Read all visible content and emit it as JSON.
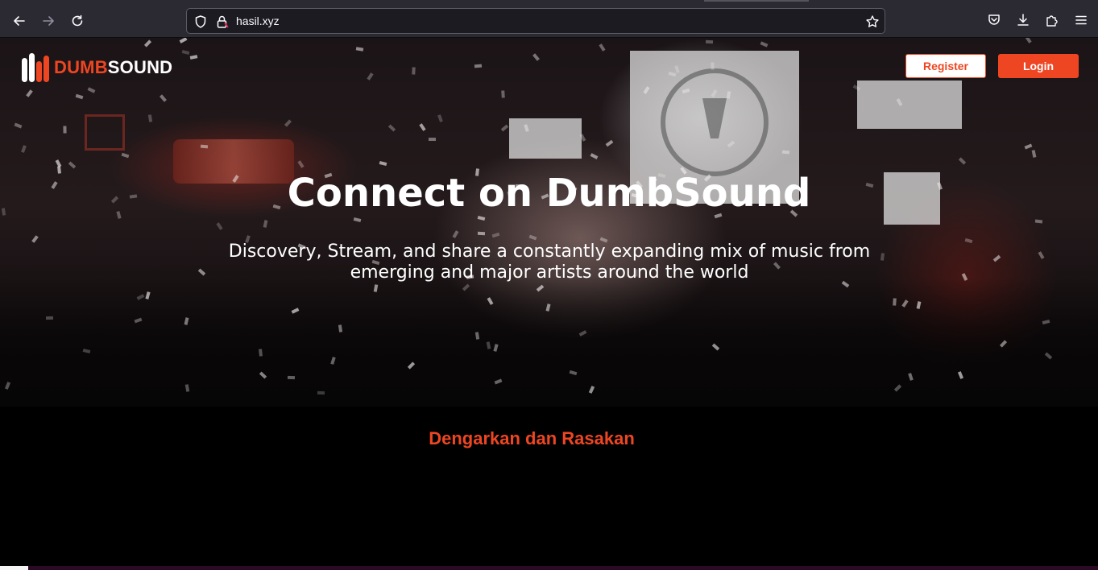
{
  "browser": {
    "url": "hasil.xyz",
    "icons": {
      "back": "arrow-left-icon",
      "forward": "arrow-right-icon",
      "reload": "reload-icon",
      "tracking": "shield-icon",
      "site": "lock-icon",
      "bookmark": "star-icon",
      "pocket": "pocket-icon",
      "downloads": "download-icon",
      "extensions": "puzzle-icon",
      "menu": "hamburger-menu-icon"
    }
  },
  "header": {
    "logo_red": "DUMB",
    "logo_white": "SOUND",
    "register_label": "Register",
    "login_label": "Login"
  },
  "hero": {
    "title": "Connect on DumbSound",
    "subtitle": "Discovery, Stream, and share a constantly expanding mix of music from emerging and major artists around the world"
  },
  "main": {
    "section_title": "Dengarkan dan Rasakan"
  },
  "colors": {
    "accent": "#ee4622",
    "browser_bar": "#2b2a33",
    "urlbar": "#1c1b22"
  }
}
